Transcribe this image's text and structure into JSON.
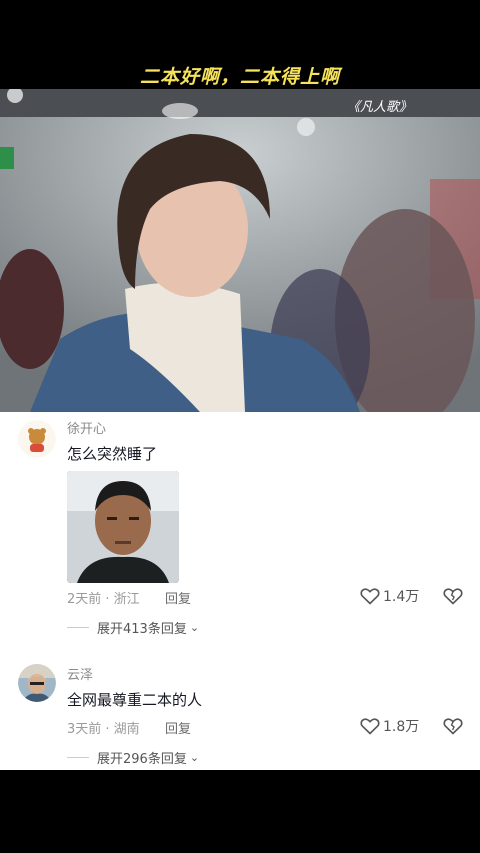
{
  "video": {
    "caption": "二本好啊，二本得上啊",
    "show_tag": "《凡人歌》"
  },
  "comments": [
    {
      "username": "徐开心",
      "text": "怎么突然睡了",
      "meta": "2天前 · 浙江",
      "reply_label": "回复",
      "likes": "1.4万",
      "expand_label": "展开413条回复"
    },
    {
      "username": "云泽",
      "text": "全网最尊重二本的人",
      "meta": "3天前 · 湖南",
      "reply_label": "回复",
      "likes": "1.8万",
      "expand_label": "展开296条回复"
    }
  ],
  "colors": {
    "caption": "#f7e35a",
    "text": "#161823",
    "meta": "#9a9a9a"
  },
  "icons": [
    "heart-icon",
    "dislike-heart-icon",
    "chevron-down-icon"
  ]
}
